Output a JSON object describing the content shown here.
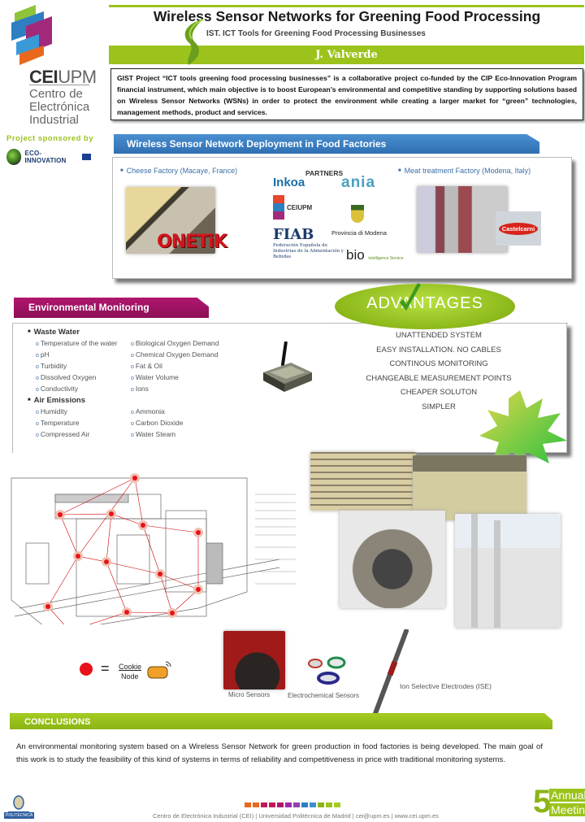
{
  "header": {
    "title": "Wireless Sensor Networks for Greening Food Processing",
    "subtitle": "IST. ICT Tools for Greening Food Processing Businesses",
    "author": "J. Valverde",
    "intro": "GIST Project “ICT tools greening food processing businesses” is a collaborative project co-funded by the CIP Eco-Innovation Program financial instrument, which main objective is to boost European’s environmental and competitive standing by supporting solutions based on Wireless Sensor Networks (WSNs) in order to protect the environment while creating a larger market for “green” technologies, management methods, product and services."
  },
  "sidebar": {
    "org_short_bold": "CEI",
    "org_short_light": "UPM",
    "org_full_1": "Centro de",
    "org_full_2": "Electrónica",
    "org_full_3": "Industrial",
    "sponsor_label": "Project  sponsored  by",
    "sponsor_name": "ECO-INNOVATION"
  },
  "deployment": {
    "title": "Wireless Sensor Network Deployment in Food Factories",
    "cheese_factory": "Cheese Factory (Macaye, France)",
    "cheese_brand": "ONETiK",
    "partners_label": "PARTNERS",
    "partners": {
      "inkoa": "Inkoa",
      "ania": "ania",
      "ceiupm": "CEIUPM",
      "fiab": "FIAB",
      "fiab_sub": "Federación Española de Industrias de la Alimentación y Bebidas",
      "modena": "Provincia di Modena",
      "bio": "bio",
      "bio_sub": "intelligence Service"
    },
    "meat_factory": "Meat treatment Factory (Modena, Italy)",
    "meat_brand": "Castelcarni"
  },
  "environmental": {
    "title": "Environmental Monitoring",
    "waste_water_label": "Waste Water",
    "waste_water": [
      [
        "Temperature of the water",
        "Biological Oxygen Demand"
      ],
      [
        "pH",
        "Chemical Oxygen Demand"
      ],
      [
        "Turbidity",
        "Fat & Oil"
      ],
      [
        "Dissolved Oxygen",
        "Water Volume"
      ],
      [
        "Conductivity",
        "Ions"
      ]
    ],
    "air_label": "Air Emissions",
    "air": [
      [
        "Humidity",
        "Ammonia"
      ],
      [
        "Temperature",
        "Carbon Dioxide"
      ],
      [
        "Compressed Air",
        "Water Steam"
      ]
    ]
  },
  "advantages": {
    "title": "ADVANTAGES",
    "items": [
      "UNATTENDED SYSTEM",
      "EASY INSTALLATION. NO CABLES",
      "CONTINOUS MONITORING",
      "CHANGEABLE MEASUREMENT POINTS",
      "CHEAPER SOLUTON",
      "SIMPLER"
    ]
  },
  "sensors": {
    "legend_eq": "=",
    "cookie": "Cookie",
    "node": "Node",
    "micro": "Micro Sensors",
    "electro": "Electrochemical Sensors",
    "ise": "Ion Selective Electrodes (ISE)"
  },
  "conclusions": {
    "title": "CONCLUSIONS",
    "text": "An environmental monitoring system based on a Wireless Sensor Network for green production in food factories is being developed. The main goal of this work is to study the feasibility of this kind of systems in terms of reliability and competitiveness in price with traditional monitoring systems."
  },
  "footer": {
    "upm_label": "POLITÉCNICA",
    "text": "Centro de Electrónica Industrial (CEI) | Universidad Politécnica de Madrid | cei@upm.es | www.cei.upm.es",
    "annual_number": "5",
    "annual_1": "Annual",
    "annual_2": "Meeting",
    "color_bar": [
      "#e8691e",
      "#e8691e",
      "#c2185b",
      "#c2185b",
      "#b0166e",
      "#9c27b0",
      "#8e44ad",
      "#2d7fc1",
      "#3b8fd0",
      "#8cb414",
      "#9bc31c",
      "#a4cc22"
    ]
  },
  "colors": {
    "brand_green": "#9bc31c",
    "section_blue": "#2f6fb3",
    "section_purple": "#8c0f56",
    "node_red": "#e8121a"
  }
}
